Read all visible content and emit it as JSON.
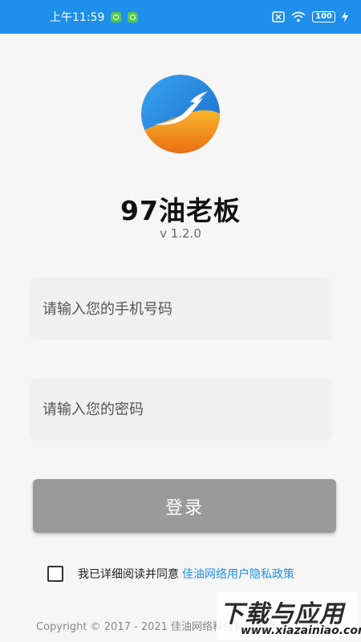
{
  "status_bar": {
    "time": "上午11:59",
    "battery": "100",
    "accent_color": "#1e8fea"
  },
  "app": {
    "title": "97油老板",
    "version": "v 1.2.0",
    "logo_icon": "app-logo-icon"
  },
  "form": {
    "phone_placeholder": "请输入您的手机号码",
    "phone_value": "",
    "password_placeholder": "请输入您的密码",
    "password_value": "",
    "login_label": "登录",
    "login_button_color": "#9a9a9a"
  },
  "agreement": {
    "checked": false,
    "text": "我已详细阅读并同意",
    "link_text": "佳油网络用户隐私政策"
  },
  "footer": {
    "copyright": "Copyright © 2017 - 2021 佳油网络科技有限公司"
  },
  "watermark": {
    "main": "下载与应用",
    "sub": "www.xiazainiao.com"
  }
}
